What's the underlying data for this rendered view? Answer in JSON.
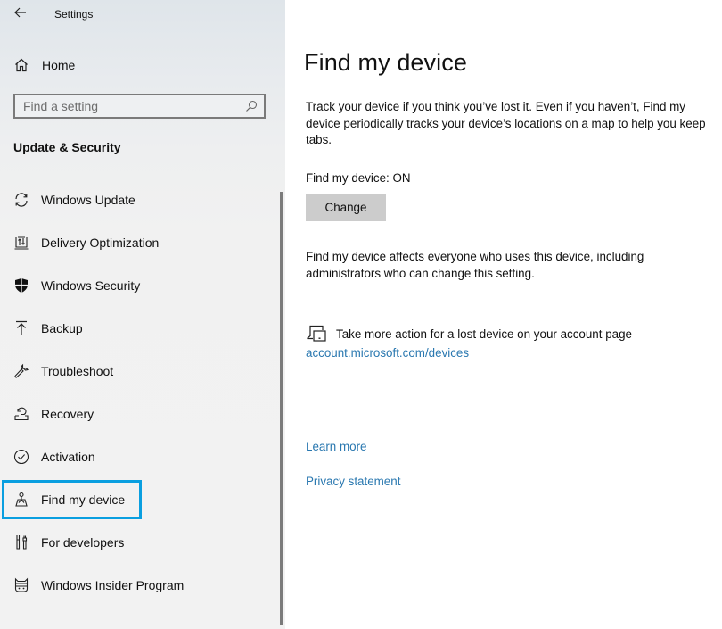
{
  "window": {
    "title": "Settings",
    "back_icon": "arrow-left-icon"
  },
  "sidebar": {
    "home": {
      "label": "Home",
      "icon": "home-icon"
    },
    "search": {
      "placeholder": "Find a setting",
      "value": "",
      "icon": "search-icon"
    },
    "section_title": "Update & Security",
    "items": [
      {
        "label": "Windows Update",
        "icon": "sync-icon",
        "selected": false
      },
      {
        "label": "Delivery Optimization",
        "icon": "delivery-optimization-icon",
        "selected": false
      },
      {
        "label": "Windows Security",
        "icon": "shield-icon",
        "selected": false
      },
      {
        "label": "Backup",
        "icon": "upload-icon",
        "selected": false
      },
      {
        "label": "Troubleshoot",
        "icon": "wrench-icon",
        "selected": false
      },
      {
        "label": "Recovery",
        "icon": "recovery-icon",
        "selected": false
      },
      {
        "label": "Activation",
        "icon": "check-circle-icon",
        "selected": false
      },
      {
        "label": "Find my device",
        "icon": "person-location-icon",
        "selected": true
      },
      {
        "label": "For developers",
        "icon": "developer-tools-icon",
        "selected": false
      },
      {
        "label": "Windows Insider Program",
        "icon": "ninja-cat-icon",
        "selected": false
      }
    ],
    "highlight_color": "#0a9fe0"
  },
  "main": {
    "title": "Find my device",
    "description": "Track your device if you think you’ve lost it. Even if you haven’t, Find my device periodically tracks your device’s locations on a map to help you keep tabs.",
    "status_text": "Find my device: ON",
    "change_button": "Change",
    "affects_text": "Find my device affects everyone who uses this device, including administrators who can change this setting.",
    "action_text": "Take more action for a lost device on your account page",
    "action_icon": "devices-icon",
    "account_link": "account.microsoft.com/devices",
    "learn_more": "Learn more",
    "privacy_statement": "Privacy statement",
    "link_color": "#2a78b0"
  }
}
